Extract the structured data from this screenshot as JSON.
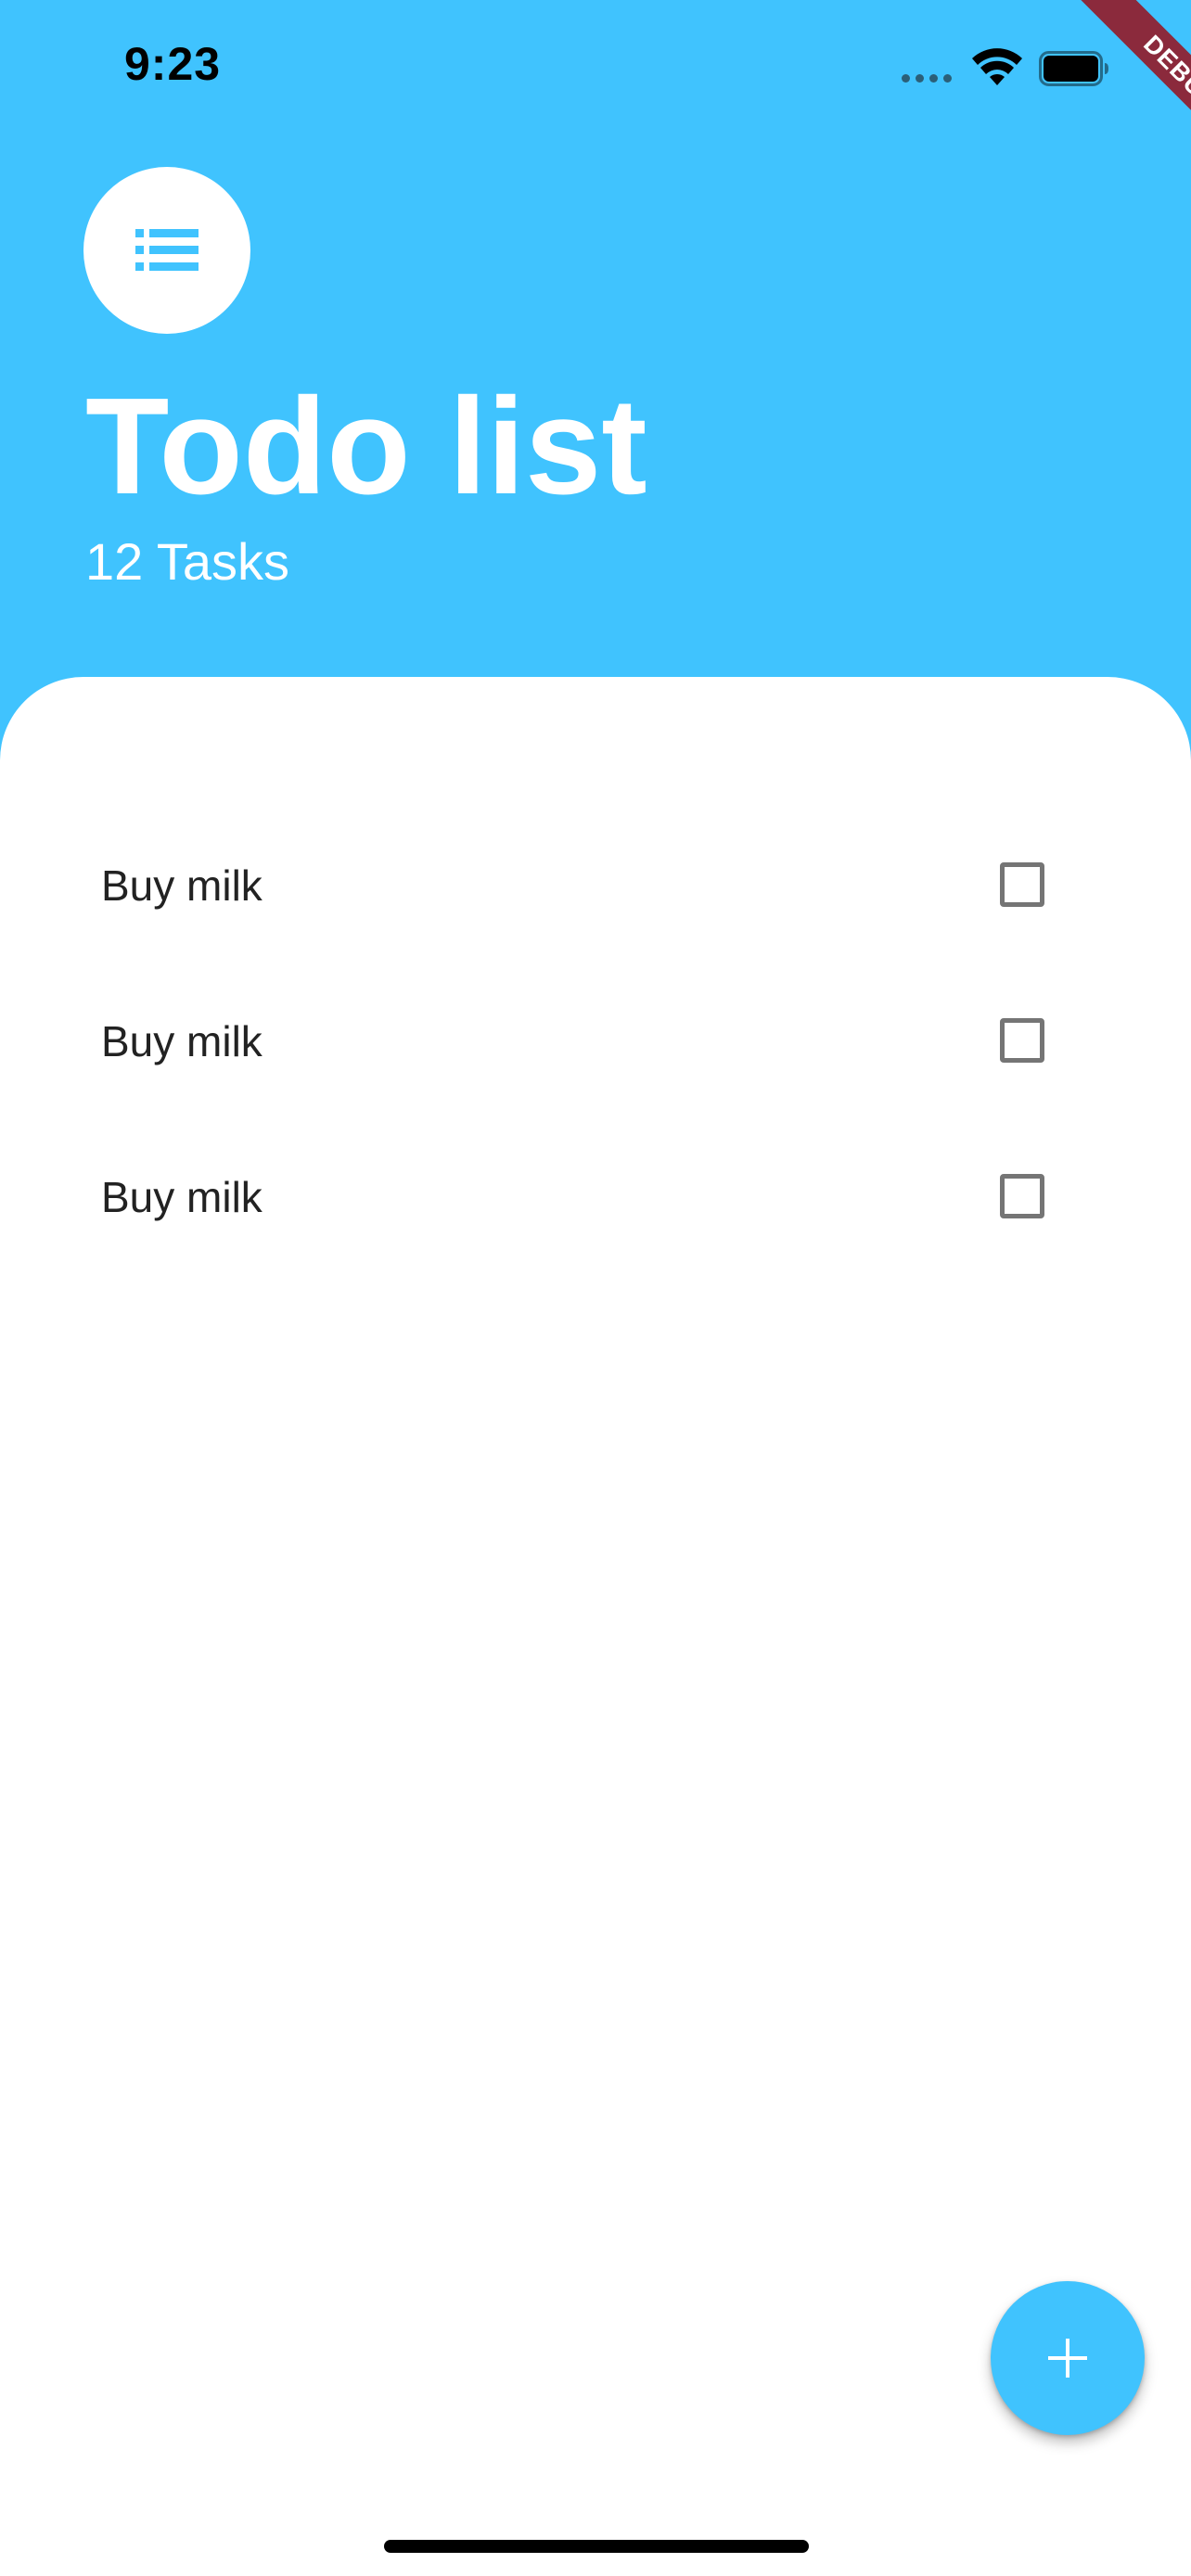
{
  "status_bar": {
    "time": "9:23",
    "signal_icon": "signal-dots-icon",
    "wifi_icon": "wifi-icon",
    "battery_icon": "battery-icon"
  },
  "debug_banner": {
    "label": "DEBUG",
    "color": "#8B2A3C"
  },
  "header": {
    "icon": "list-icon",
    "title": "Todo list",
    "subtitle": "12 Tasks"
  },
  "todos": [
    {
      "label": "Buy milk",
      "checked": false
    },
    {
      "label": "Buy milk",
      "checked": false
    },
    {
      "label": "Buy milk",
      "checked": false
    }
  ],
  "fab": {
    "icon": "add-icon"
  },
  "colors": {
    "accent": "#40C3FE",
    "background": "#FFFFFF",
    "text": "#222222",
    "checkbox_border": "#757575"
  }
}
